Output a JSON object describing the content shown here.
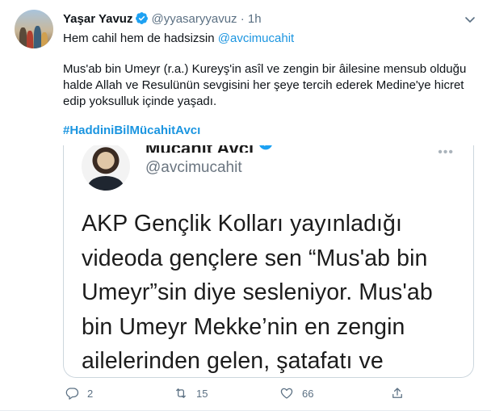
{
  "author": {
    "name": "Yaşar Yavuz",
    "handle": "@yyasaryyavuz",
    "separator": "·",
    "time": "1h"
  },
  "tweet": {
    "line1_text": "Hem cahil hem de hadsizsin ",
    "line1_mention": "@avcimucahit",
    "paragraph": "Mus'ab bin Umeyr (r.a.) Kureyş'in asîl ve zengin bir âilesine mensub olduğu halde Allah ve Resulünün sevgisini her şeye tercih ederek Medine'ye hicret edip yoksulluk içinde yaşadı.",
    "hashtag": "#HaddiniBilMücahitAvcı"
  },
  "quoted_image": {
    "name": "Mücahit Avcı",
    "handle": "@avcimucahit",
    "more": "•••",
    "lines": [
      "AKP Gençlik Kolları yayınladığı",
      "videoda gençlere sen “Mus'ab bin",
      "Umeyr”sin diye sesleniyor. Mus'ab",
      "bin Umeyr Mekke’nin en zengin",
      "ailelerinden gelen, şatafatı ve"
    ]
  },
  "actions": {
    "reply_count": "2",
    "retweet_count": "15",
    "like_count": "66"
  },
  "colors": {
    "accent": "#1b95e0",
    "muted": "#5b7083",
    "verified": "#1da1f2"
  },
  "icons": [
    "avatar",
    "verified-badge-icon",
    "chevron-down-icon",
    "reply-icon",
    "retweet-icon",
    "like-icon",
    "share-icon"
  ]
}
